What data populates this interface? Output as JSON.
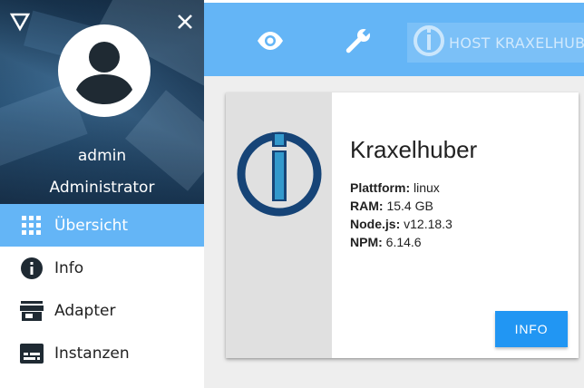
{
  "sidebar": {
    "user": {
      "name": "admin",
      "role": "Administrator"
    },
    "items": [
      {
        "label": "Übersicht",
        "icon": "grid-icon",
        "active": true
      },
      {
        "label": "Info",
        "icon": "info-icon",
        "active": false
      },
      {
        "label": "Adapter",
        "icon": "store-icon",
        "active": false
      },
      {
        "label": "Instanzen",
        "icon": "subtitles-icon",
        "active": false
      }
    ]
  },
  "topbar": {
    "icons": [
      "eye-icon",
      "wrench-icon"
    ],
    "host_label": "HOST KRAXELHUBER"
  },
  "card": {
    "title": "Kraxelhuber",
    "lines": [
      {
        "key": "Plattform:",
        "value": "linux"
      },
      {
        "key": "RAM:",
        "value": "15.4 GB"
      },
      {
        "key": "Node.js:",
        "value": "v12.18.3"
      },
      {
        "key": "NPM:",
        "value": "6.14.6"
      }
    ],
    "button_label": "INFO"
  },
  "colors": {
    "primary": "#64b5f6",
    "button": "#2196f3",
    "logo": "#164477",
    "logo_accent": "#3399cc"
  }
}
